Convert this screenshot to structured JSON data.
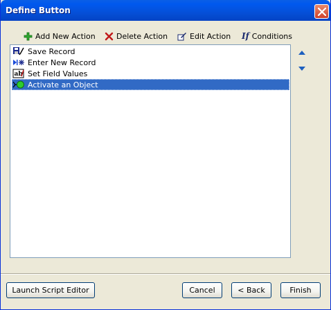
{
  "window": {
    "title": "Define Button"
  },
  "toolbar": {
    "add_label": "Add New Action",
    "delete_label": "Delete Action",
    "edit_label": "Edit Action",
    "conditions_label": "Conditions"
  },
  "actions": [
    {
      "label": "Save Record",
      "icon": "save-record-icon"
    },
    {
      "label": "Enter New Record",
      "icon": "new-record-icon"
    },
    {
      "label": "Set Field Values",
      "icon": "set-field-icon"
    },
    {
      "label": "Activate an Object",
      "icon": "activate-object-icon",
      "selected": true
    }
  ],
  "buttons": {
    "launch_script": "Launch Script Editor",
    "cancel": "Cancel",
    "back": "< Back",
    "finish": "Finish"
  },
  "colors": {
    "selection": "#316ac5",
    "title_bar": "#0550d8",
    "dialog_bg": "#ece9d8"
  }
}
